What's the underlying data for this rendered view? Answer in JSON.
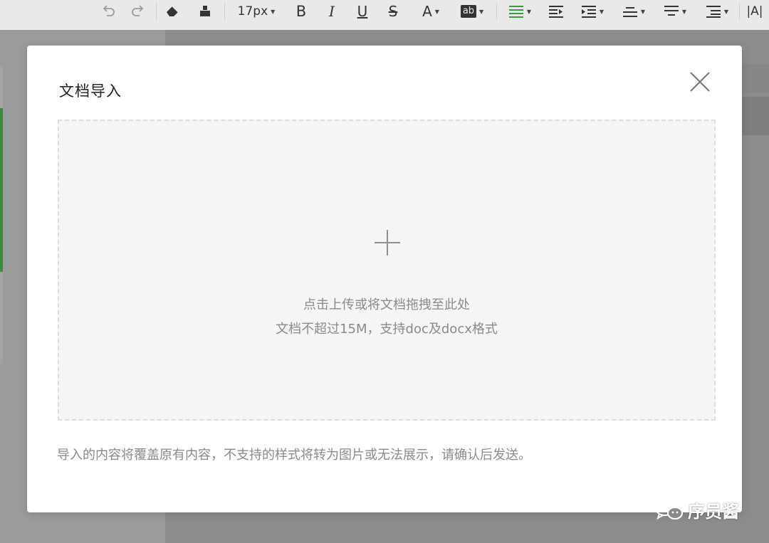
{
  "toolbar": {
    "font_size": "17px",
    "bold": "B",
    "italic": "I",
    "underline": "U",
    "strike": "S",
    "font_color": "A",
    "highlight": "ab",
    "caption": "|A|"
  },
  "modal": {
    "title": "文档导入",
    "dropzone": {
      "line1": "点击上传或将文档拖拽至此处",
      "line2": "文档不超过15M，支持doc及docx格式"
    },
    "note": "导入的内容将覆盖原有内容，不支持的样式将转为图片或无法展示，请确认后发送。"
  },
  "watermark": {
    "text": "序员酱"
  },
  "colors": {
    "accent_green": "#2f9e44",
    "dropzone_bg": "#f4f5f7",
    "overlay": "#8a8a8a"
  }
}
